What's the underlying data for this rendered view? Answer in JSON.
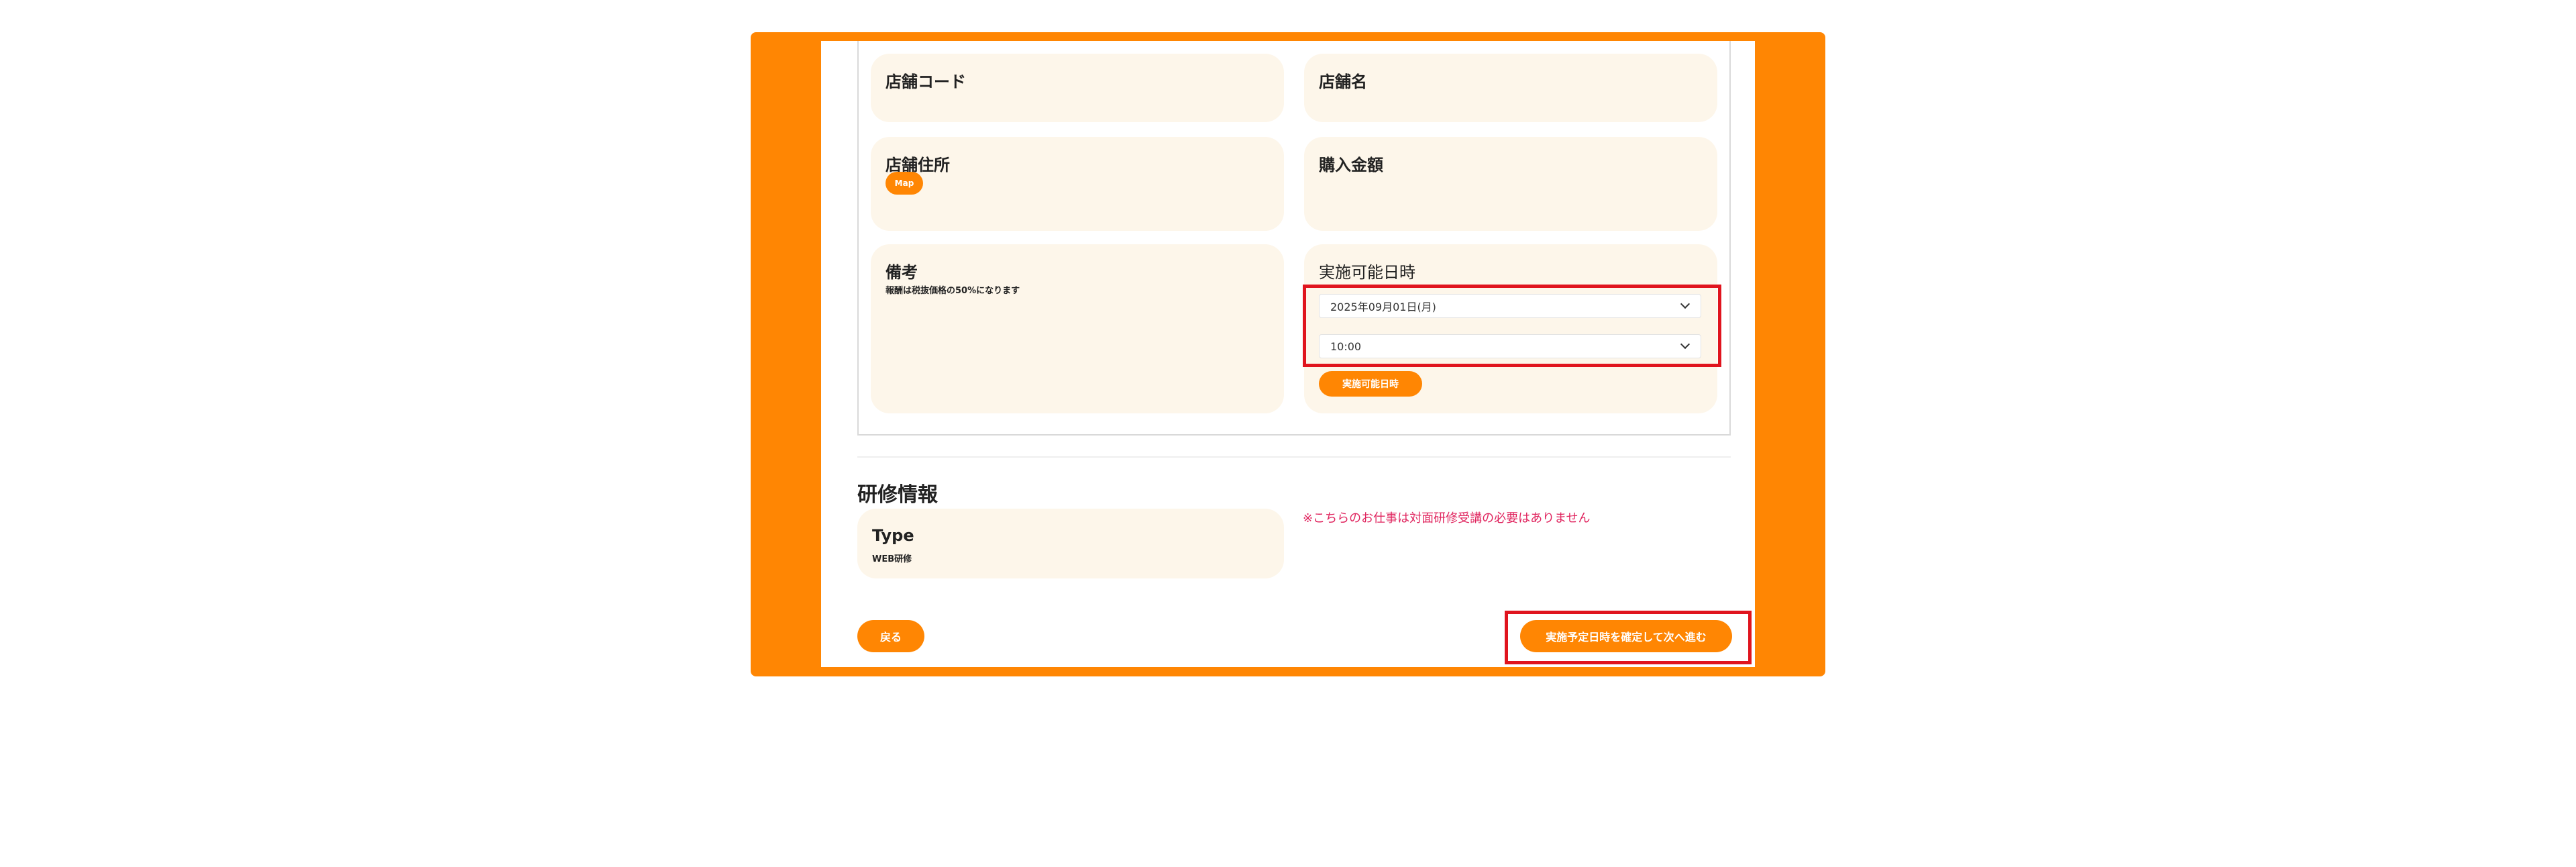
{
  "store": {
    "code_label": "店舗コード",
    "name_label": "店舗名",
    "address_label": "店舗住所",
    "map_button": "Map",
    "purchase_label": "購入金額",
    "remarks_label": "備考",
    "remarks_note": "報酬は税抜価格の50%になります",
    "available_label": "実施可能日時",
    "date_value": "2025年09月01日(月)",
    "time_value": "10:00",
    "available_button": "実施可能日時"
  },
  "training": {
    "heading": "研修情報",
    "type_label": "Type",
    "type_value": "WEB研修",
    "notice": "※こちらのお仕事は対面研修受講の必要はありません"
  },
  "footer": {
    "back_button": "戻る",
    "confirm_button": "実施予定日時を確定して次へ進む"
  },
  "colors": {
    "accent": "#ff8603",
    "field_bg": "#fdf6ea",
    "highlight": "#e0141e",
    "notice": "#e0245e"
  }
}
